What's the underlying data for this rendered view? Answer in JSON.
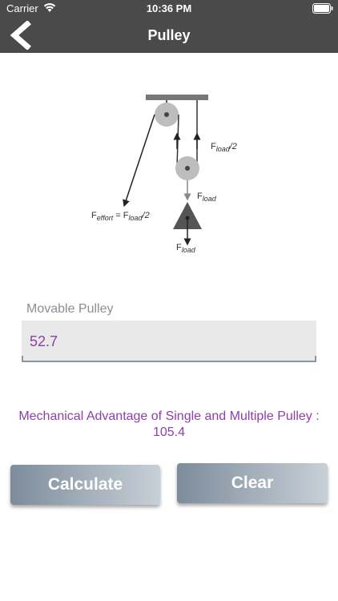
{
  "status": {
    "carrier": "Carrier",
    "time": "10:36 PM"
  },
  "nav": {
    "title": "Pulley"
  },
  "diagram": {
    "label_half_load": "F",
    "label_half_load_sub": "load",
    "label_half_load_suffix": "/2",
    "label_load": "F",
    "label_load_sub": "load",
    "label_effort": "F",
    "label_effort_sub": "effort",
    "label_effort_eq": " = F",
    "label_effort_eq_sub": "load",
    "label_effort_suffix": "/2",
    "label_bottom_load": "F",
    "label_bottom_load_sub": "load"
  },
  "form": {
    "label": "Movable Pulley",
    "value": "52.7"
  },
  "result": {
    "text": "Mechanical Advantage of Single and Multiple Pulley : 105.4"
  },
  "buttons": {
    "calculate": "Calculate",
    "clear": "Clear"
  },
  "colors": {
    "bar": "#4a4a4a",
    "accent_text": "#8e3fa8",
    "label_gray": "#8a8f96"
  }
}
